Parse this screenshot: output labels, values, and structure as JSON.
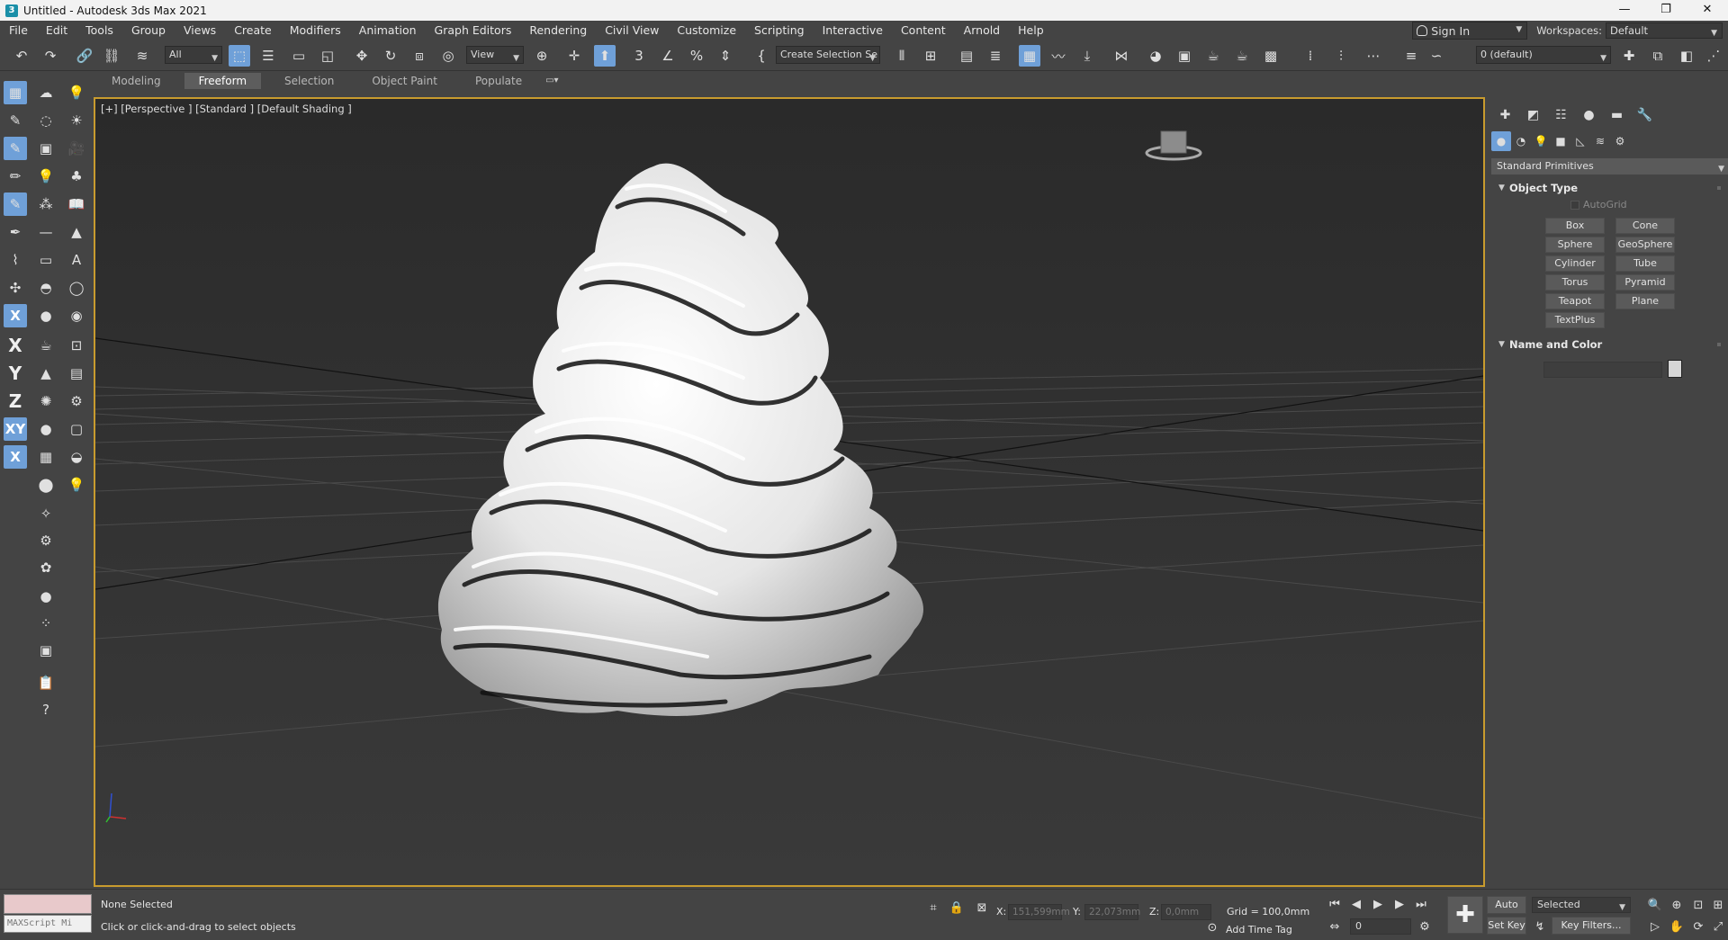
{
  "window": {
    "title": "Untitled - Autodesk 3ds Max 2021",
    "minimize": "—",
    "restore": "❐",
    "close": "✕"
  },
  "menu": [
    "File",
    "Edit",
    "Tools",
    "Group",
    "Views",
    "Create",
    "Modifiers",
    "Animation",
    "Graph Editors",
    "Rendering",
    "Civil View",
    "Customize",
    "Scripting",
    "Interactive",
    "Content",
    "Arnold",
    "Help"
  ],
  "account": {
    "sign_in": "Sign In",
    "workspaces_label": "Workspaces:",
    "workspace": "Default"
  },
  "toolbar": {
    "selection_filter": "All",
    "ref_coord": "View",
    "named_selection": "Create Selection Se",
    "layer": "0 (default)"
  },
  "ribbon_tabs": [
    "Modeling",
    "Freeform",
    "Selection",
    "Object Paint",
    "Populate"
  ],
  "ribbon_active": "Freeform",
  "viewport": {
    "label": "[+] [Perspective ] [Standard ] [Default Shading ]"
  },
  "command_panel": {
    "category": "Standard Primitives",
    "object_type_title": "Object Type",
    "autogrid": "AutoGrid",
    "primitives": [
      "Box",
      "Cone",
      "Sphere",
      "GeoSphere",
      "Cylinder",
      "Tube",
      "Torus",
      "Pyramid",
      "Teapot",
      "Plane",
      "TextPlus"
    ],
    "name_color_title": "Name and Color"
  },
  "status": {
    "maxscript_placeholder": "MAXScript Mi",
    "selection_text": "None Selected",
    "prompt_text": "Click or click-and-drag to select objects",
    "x_label": "X:",
    "x_value": "151,599mm",
    "y_label": "Y:",
    "y_value": "22,073mm",
    "z_label": "Z:",
    "z_value": "0,0mm",
    "grid": "Grid = 100,0mm",
    "add_time_tag": "Add Time Tag",
    "frame": "0",
    "auto_key": "Auto K..",
    "set_key": "Set Key",
    "key_mode": "Selected",
    "key_filters": "Key Filters..."
  }
}
